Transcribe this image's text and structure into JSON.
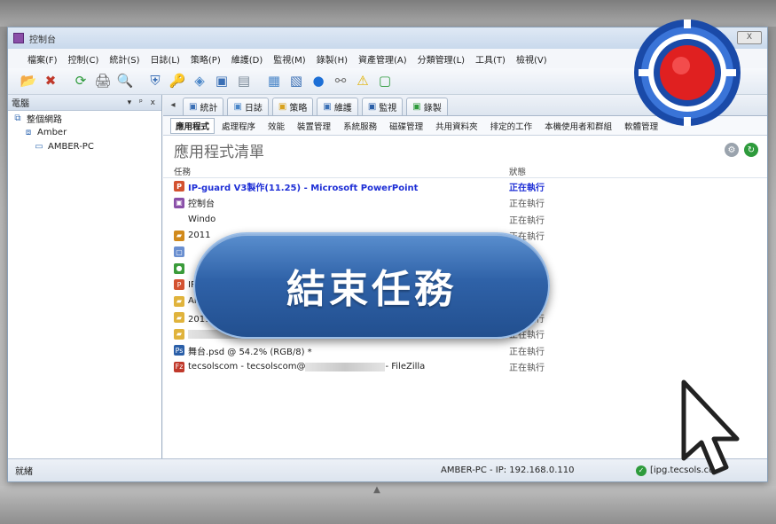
{
  "window": {
    "title": "控制台",
    "close_label": "X"
  },
  "menu": [
    {
      "label": "檔案(F)"
    },
    {
      "label": "控制(C)"
    },
    {
      "label": "統計(S)"
    },
    {
      "label": "日誌(L)"
    },
    {
      "label": "策略(P)"
    },
    {
      "label": "維護(D)"
    },
    {
      "label": "監視(M)"
    },
    {
      "label": "錄製(H)"
    },
    {
      "label": "資產管理(A)"
    },
    {
      "label": "分類管理(L)"
    },
    {
      "label": "工具(T)"
    },
    {
      "label": "檢視(V)"
    }
  ],
  "toolbar": {
    "icons": [
      "add-icon",
      "delete-icon",
      "refresh-icon",
      "print-icon",
      "preview-icon",
      "security-icon",
      "key-icon",
      "cube-icon",
      "screen-icon",
      "disk-icon",
      "chart-icon",
      "report-icon",
      "globe-icon",
      "link-icon",
      "warning-icon",
      "document-icon"
    ]
  },
  "tree": {
    "header": "電腦",
    "controls": "▾ ᵖ x",
    "items": [
      {
        "label": "整個網路",
        "icon": "network-icon"
      },
      {
        "label": "Amber",
        "icon": "group-icon"
      },
      {
        "label": "AMBER-PC",
        "icon": "computer-icon"
      }
    ]
  },
  "tabs_top": [
    {
      "label": "統計",
      "icon": "stats-icon"
    },
    {
      "label": "日誌",
      "icon": "log-icon"
    },
    {
      "label": "策略",
      "icon": "policy-icon"
    },
    {
      "label": "維護",
      "icon": "maintain-icon"
    },
    {
      "label": "監視",
      "icon": "monitor-icon"
    },
    {
      "label": "錄製",
      "icon": "record-icon"
    }
  ],
  "tabs_sub": [
    {
      "label": "應用程式",
      "active": true
    },
    {
      "label": "處理程序"
    },
    {
      "label": "效能"
    },
    {
      "label": "裝置管理"
    },
    {
      "label": "系統服務"
    },
    {
      "label": "磁碟管理"
    },
    {
      "label": "共用資料夾"
    },
    {
      "label": "排定的工作"
    },
    {
      "label": "本機使用者和群組"
    },
    {
      "label": "軟體管理"
    }
  ],
  "list": {
    "title": "應用程式清單",
    "col_task": "任務",
    "col_status": "狀態",
    "rows": [
      {
        "task": "IP-guard V3製作(11.25) - Microsoft PowerPoint",
        "status": "正在執行",
        "icon": "powerpoint-icon",
        "color": "#d35230",
        "selected": true
      },
      {
        "task": "控制台",
        "status": "正在執行",
        "icon": "console-icon",
        "color": "#8a4fa8"
      },
      {
        "task": "Windo",
        "status": "正在執行",
        "icon": "",
        "color": ""
      },
      {
        "task": "2011",
        "status": "正在執行",
        "icon": "folder-icon",
        "color": "#d18a1c"
      },
      {
        "task": "",
        "status": "",
        "icon": "doc-icon",
        "color": "#6a8fd0"
      },
      {
        "task": "",
        "status": "",
        "icon": "chrome-icon",
        "color": "#3a9b3a"
      },
      {
        "task": "IP",
        "status": "",
        "icon": "powerpoint-icon",
        "color": "#d35230"
      },
      {
        "task": "Amb",
        "status": "正在執行",
        "icon": "folder-icon",
        "color": "#e0b33c"
      },
      {
        "task": "2011Q2新聞稿",
        "status": "正在執行",
        "icon": "folder-icon",
        "color": "#e0b33c"
      },
      {
        "task": "",
        "status": "正在執行",
        "icon": "folder-icon",
        "color": "#e0b33c",
        "blurred": true
      },
      {
        "task": "舞台.psd @ 54.2% (RGB/8) *",
        "status": "正在執行",
        "icon": "photoshop-icon",
        "color": "#2b5fa8"
      },
      {
        "task": "tecsolscom - tecsolscom@",
        "task_suffix": " - FileZilla",
        "status": "正在執行",
        "icon": "filezilla-icon",
        "color": "#c0392b",
        "blurred_mid": true
      }
    ]
  },
  "statusbar": {
    "left": "就緒",
    "mid": "AMBER-PC - IP: 192.168.0.110",
    "right": "[ipg.tecsols.co"
  },
  "overlay": {
    "label": "結束任務"
  },
  "colors": {
    "accent": "#2f62a8",
    "selected_text": "#1e2fd6",
    "logo_red": "#e02020",
    "logo_blue": "#1a4aa8"
  }
}
